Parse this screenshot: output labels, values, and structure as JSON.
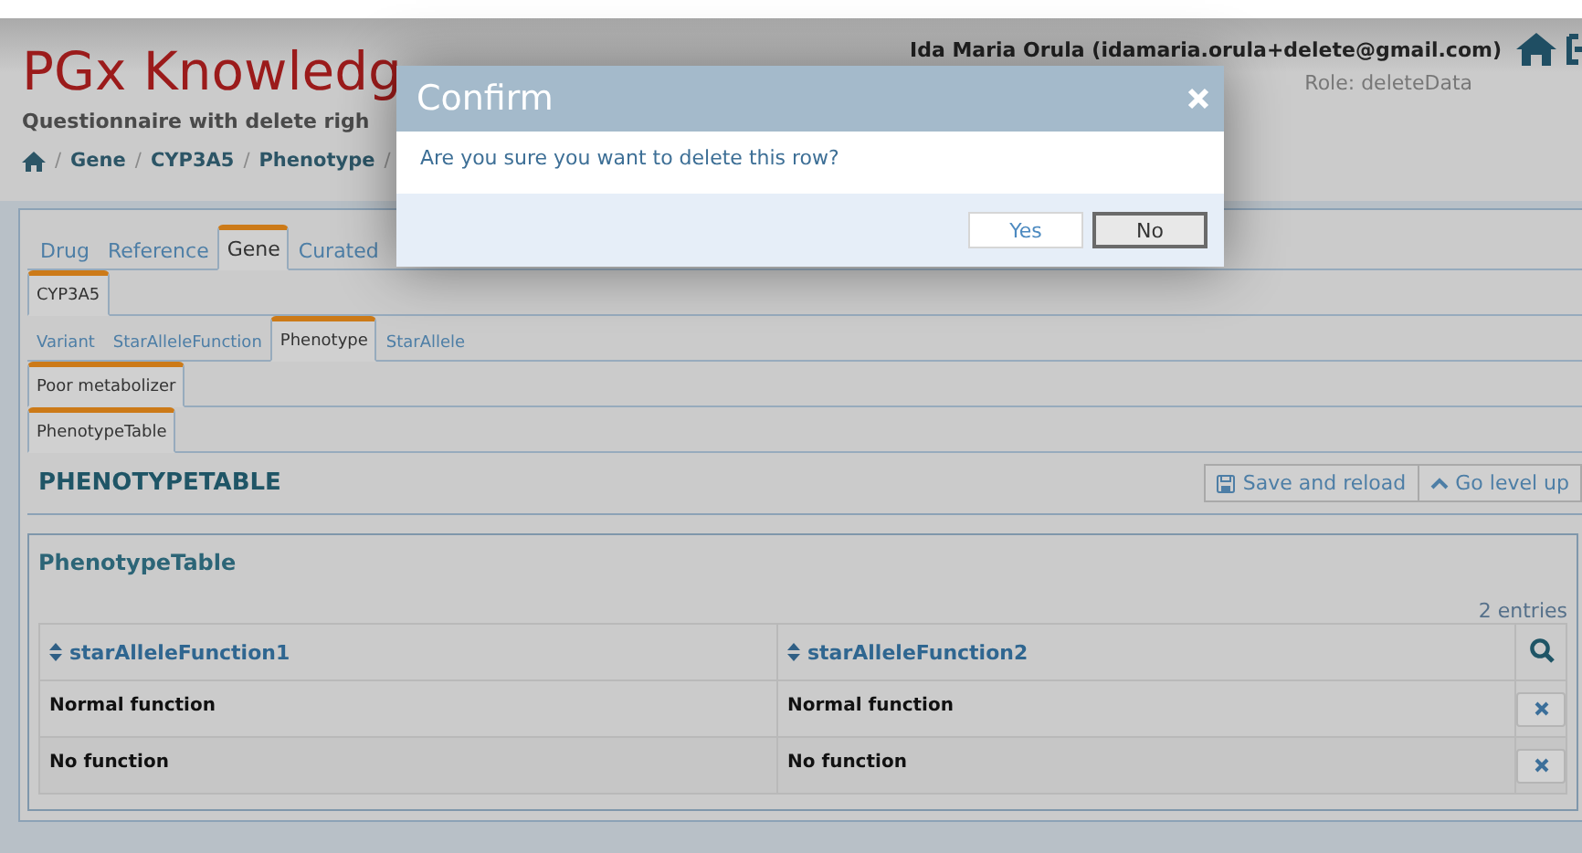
{
  "header": {
    "title": "PGx Knowledg",
    "subtitle": "Questionnaire with delete righ",
    "breadcrumb_separator": "/",
    "breadcrumb": [
      "Gene",
      "CYP3A5",
      "Phenotype"
    ],
    "user": "Ida Maria Orula (idamaria.orula+delete@gmail.com)",
    "role": "Role: deleteData"
  },
  "tab_levels": [
    [
      {
        "label": "Drug",
        "selected": false
      },
      {
        "label": "Reference",
        "selected": false
      },
      {
        "label": "Gene",
        "selected": true
      },
      {
        "label": "Curated",
        "selected": false
      }
    ],
    [
      {
        "label": "CYP3A5",
        "selected": true
      }
    ],
    [
      {
        "label": "Variant",
        "selected": false
      },
      {
        "label": "StarAlleleFunction",
        "selected": false
      },
      {
        "label": "Phenotype",
        "selected": true
      },
      {
        "label": "StarAllele",
        "selected": false
      }
    ],
    [
      {
        "label": "Poor metabolizer",
        "selected": true
      }
    ],
    [
      {
        "label": "PhenotypeTable",
        "selected": true
      }
    ]
  ],
  "section": {
    "title": "PHENOTYPETABLE",
    "buttons": [
      {
        "kind": "save",
        "label": "Save and reload"
      },
      {
        "kind": "up",
        "label": "Go level up"
      }
    ]
  },
  "table": {
    "title": "PhenotypeTable",
    "count": "2 entries",
    "columns": [
      "starAlleleFunction1",
      "starAlleleFunction2"
    ],
    "rows": [
      [
        "Normal function",
        "Normal function"
      ],
      [
        "No function",
        "No function"
      ]
    ]
  },
  "dialog": {
    "title": "Confirm",
    "message": "Are you sure you want to delete this row?",
    "buttons": [
      {
        "label": "Yes",
        "focused": false
      },
      {
        "label": "No",
        "focused": true
      }
    ]
  }
}
